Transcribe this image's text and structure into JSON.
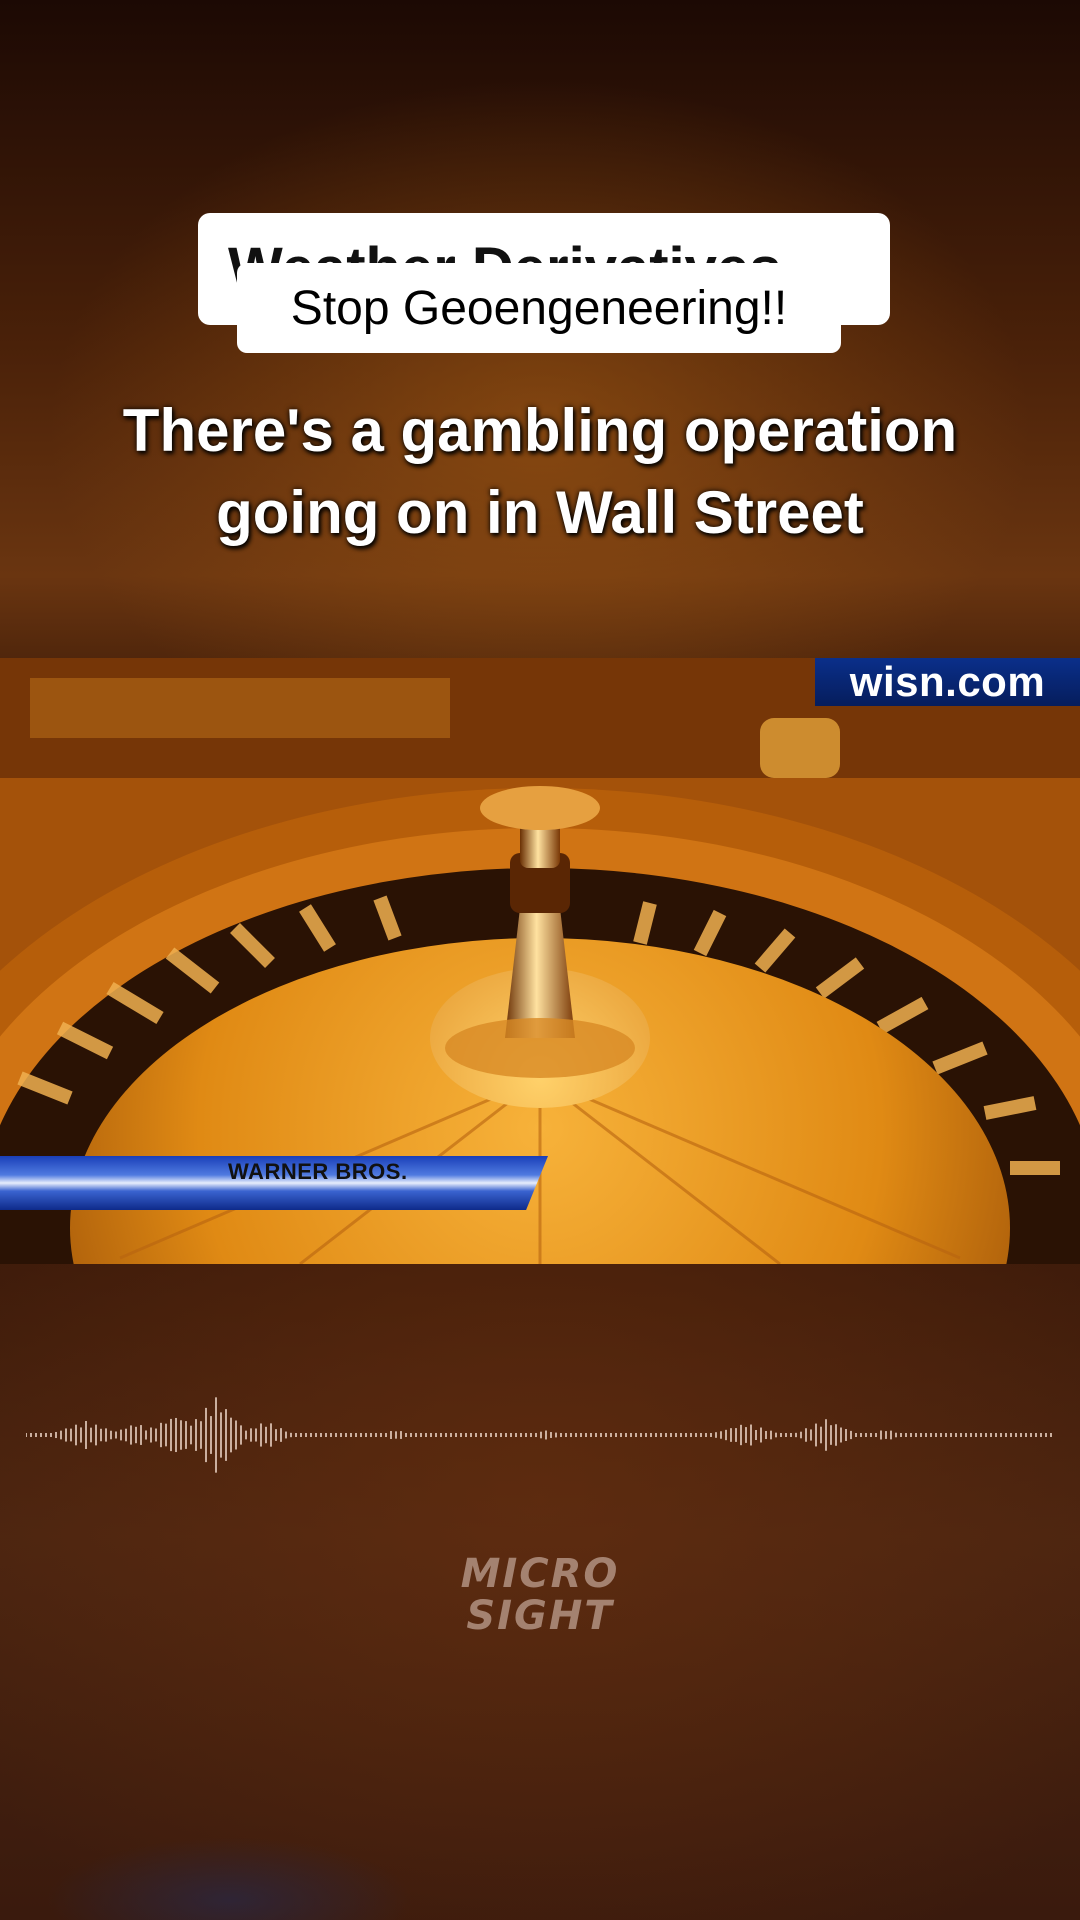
{
  "captions": {
    "back_text": "Weather Derivatives",
    "front_text": "Stop Geoengeneering!!",
    "headline_line1": "There's a gambling operation",
    "headline_line2": "going on in Wall Street"
  },
  "video": {
    "logo_text": "wisn.com",
    "lower_third_text": "WARNER BROS."
  },
  "watermark": {
    "line1": "MICRO",
    "line2": "SIGHT"
  },
  "colors": {
    "background": "#3a1608",
    "logo_blue": "#0a2f8a",
    "roulette_gold": "#e48c16"
  }
}
